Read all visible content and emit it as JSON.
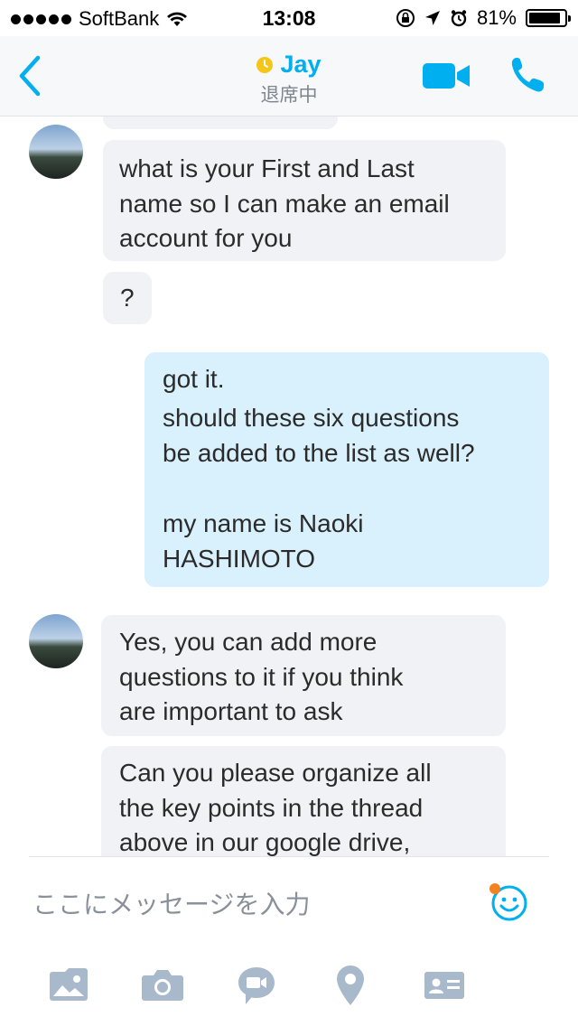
{
  "status_bar": {
    "carrier": "SoftBank",
    "time": "13:08",
    "battery": "81%"
  },
  "header": {
    "back_icon": "chevron-left-icon",
    "contact_name": "Jay",
    "contact_status": "退席中",
    "status_color": "#f5c518",
    "accent": "#00aff0"
  },
  "messages": [
    {
      "direction": "incoming",
      "lines": [
        "what is your First and Last",
        "name so I can make an email",
        "account for you"
      ]
    },
    {
      "direction": "incoming",
      "lines": [
        "?"
      ]
    },
    {
      "direction": "outgoing",
      "lines": [
        "got it.",
        "should these six questions",
        "be added to the list as well?",
        "",
        "my name is Naoki",
        "HASHIMOTO"
      ]
    },
    {
      "direction": "incoming",
      "lines": [
        "Yes, you can add more",
        "questions to it if you think",
        "are important to ask"
      ]
    },
    {
      "direction": "incoming",
      "lines": [
        "Can you please organize all",
        "the key points in the thread",
        "above in our google drive,"
      ]
    }
  ],
  "composer": {
    "placeholder": "ここにメッセージを入力"
  },
  "toolbar": {
    "items": [
      "gallery-icon",
      "camera-icon",
      "video-message-icon",
      "location-icon",
      "contact-card-icon"
    ]
  }
}
